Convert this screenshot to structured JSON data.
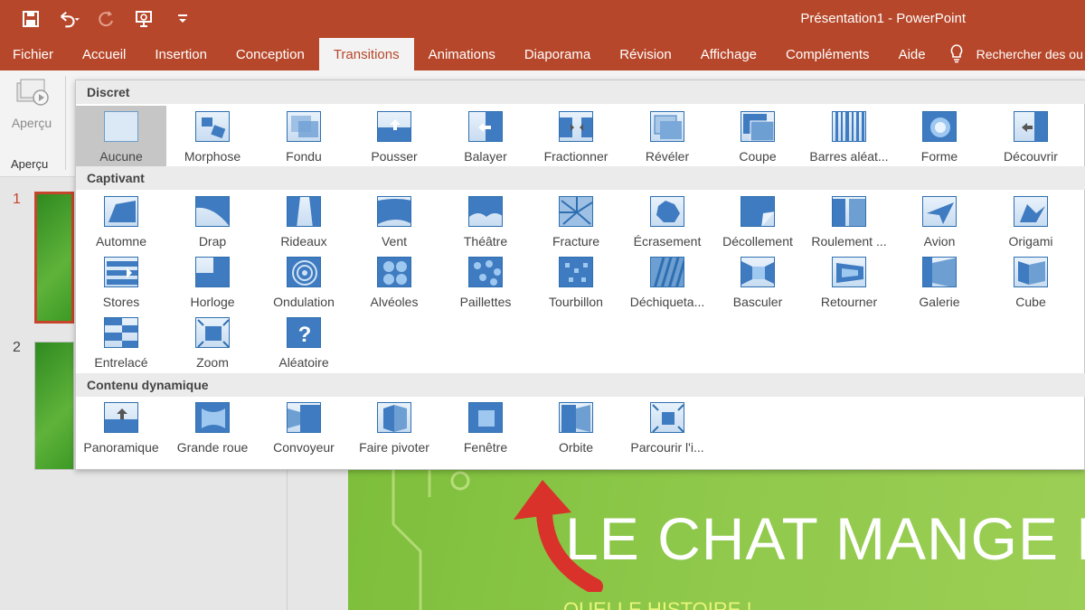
{
  "window": {
    "title": "Présentation1  -  PowerPoint"
  },
  "qat": {
    "icons": [
      "save-icon",
      "undo-icon",
      "redo-icon",
      "present-icon",
      "customize-icon"
    ]
  },
  "tabs": [
    {
      "label": "Fichier"
    },
    {
      "label": "Accueil"
    },
    {
      "label": "Insertion"
    },
    {
      "label": "Conception"
    },
    {
      "label": "Transitions",
      "active": true
    },
    {
      "label": "Animations"
    },
    {
      "label": "Diaporama"
    },
    {
      "label": "Révision"
    },
    {
      "label": "Affichage"
    },
    {
      "label": "Compléments"
    },
    {
      "label": "Aide"
    }
  ],
  "tell_me": {
    "placeholder": "Rechercher des ou"
  },
  "ribbon": {
    "preview_button": "Aperçu",
    "preview_group": "Aperçu"
  },
  "colors": {
    "accent": "#b7472a",
    "tile_border": "#2f6fb0",
    "selected": "#c6c6c6"
  },
  "slides": [
    {
      "number": "1"
    },
    {
      "number": "2"
    }
  ],
  "slide": {
    "title": "LE CHAT MANGE LA",
    "subtitle": "QUELLE HISTOIRE !"
  },
  "gallery": {
    "sections": [
      {
        "label": "Discret",
        "items": [
          "Aucune",
          "Morphose",
          "Fondu",
          "Pousser",
          "Balayer",
          "Fractionner",
          "Révéler",
          "Coupe",
          "Barres aléat...",
          "Forme",
          "Découvrir"
        ]
      },
      {
        "label": "Captivant",
        "items": [
          "Automne",
          "Drap",
          "Rideaux",
          "Vent",
          "Théâtre",
          "Fracture",
          "Écrasement",
          "Décollement",
          "Roulement ...",
          "Avion",
          "Origami",
          "Stores",
          "Horloge",
          "Ondulation",
          "Alvéoles",
          "Paillettes",
          "Tourbillon",
          "Déchiqueta...",
          "Basculer",
          "Retourner",
          "Galerie",
          "Cube",
          "Entrelacé",
          "Zoom",
          "Aléatoire"
        ]
      },
      {
        "label": "Contenu dynamique",
        "items": [
          "Panoramique",
          "Grande roue",
          "Convoyeur",
          "Faire pivoter",
          "Fenêtre",
          "Orbite",
          "Parcourir l'i..."
        ]
      }
    ],
    "selected": "Aucune"
  }
}
